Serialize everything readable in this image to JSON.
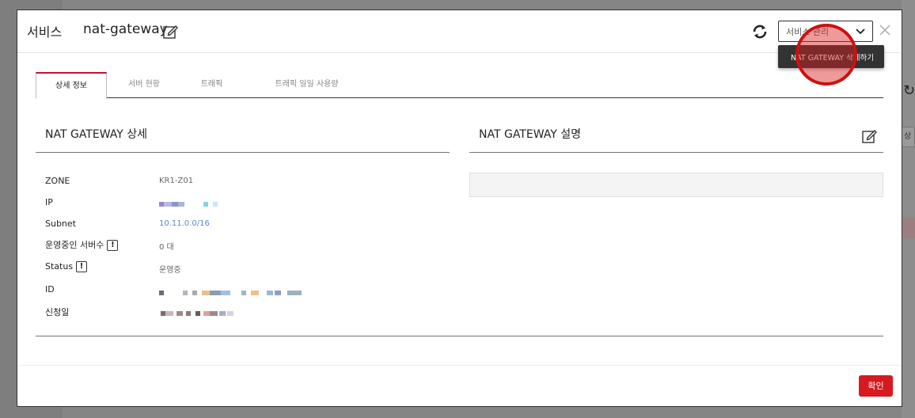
{
  "background": {
    "right_box_text": "상"
  },
  "header": {
    "kind": "서비스",
    "title": "nat-gateway",
    "service_select": "서비스 관리",
    "dropdown_item": "NAT GATEWAY 삭제하기"
  },
  "tabs": [
    {
      "label": "상세 정보",
      "active": true
    },
    {
      "label": "서버 현황",
      "active": false
    },
    {
      "label": "트래픽",
      "active": false
    },
    {
      "label": "트래픽 일일 사용량",
      "active": false
    }
  ],
  "detail": {
    "title": "NAT GATEWAY 상세",
    "rows": [
      {
        "label": "ZONE",
        "value": "KR1-Z01"
      },
      {
        "label": "IP",
        "value": ""
      },
      {
        "label": "Subnet",
        "value": "10.11.0.0/16"
      },
      {
        "label": "운영중인 서버수",
        "value": "0 대",
        "badge": "!"
      },
      {
        "label": "Status",
        "value": "운영중",
        "badge": "!"
      },
      {
        "label": "ID",
        "value": ""
      },
      {
        "label": "신청일",
        "value": ""
      }
    ]
  },
  "description": {
    "title": "NAT GATEWAY 설명",
    "value": ""
  },
  "footer": {
    "confirm_label": "확인"
  },
  "colors": {
    "accent_red": "#d71920",
    "tab_active_border": "#c8102e",
    "link_blue": "#5a8ac6"
  }
}
